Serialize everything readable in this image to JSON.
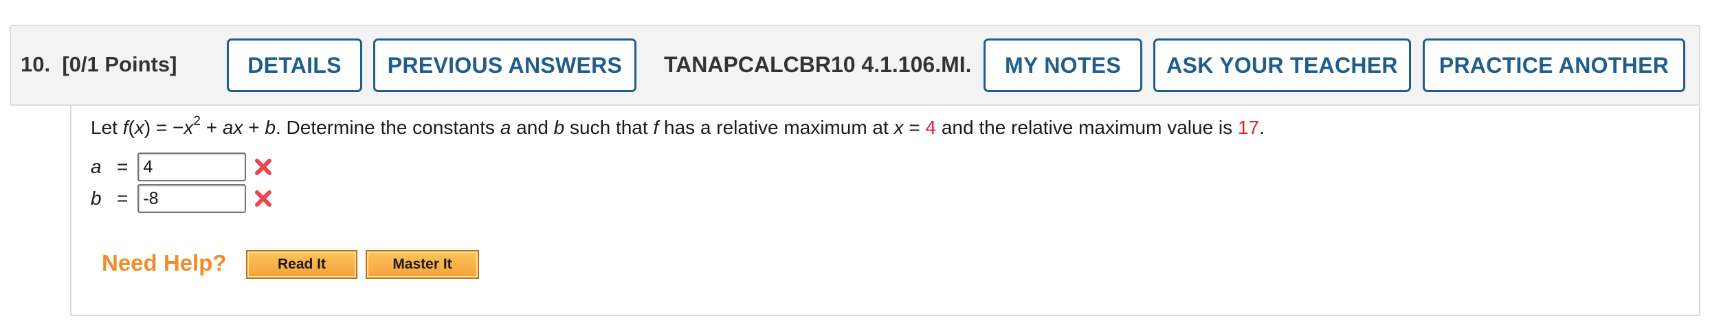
{
  "question_header": {
    "number": "10.",
    "points": "[0/1 Points]",
    "details_label": "DETAILS",
    "previous_answers_label": "PREVIOUS ANSWERS",
    "assignment_code": "TANAPCALCBR10 4.1.106.MI.",
    "my_notes_label": "MY NOTES",
    "ask_teacher_label": "ASK YOUR TEACHER",
    "practice_another_label": "PRACTICE ANOTHER"
  },
  "question": {
    "t1": "Let ",
    "f": "f",
    "t2": "(",
    "x1": "x",
    "t3": ") = −",
    "x2": "x",
    "exp": "2",
    "t4": " + ",
    "a1": "a",
    "x3": "x",
    "t5": " + ",
    "b1": "b",
    "t6": ". Determine the constants ",
    "a2": "a",
    "t7": " and ",
    "b2": "b",
    "t8": " such that ",
    "f2": "f",
    "t9": " has a relative maximum at ",
    "x4": "x",
    "t10": " = ",
    "x_value": "4",
    "t11": " and the relative maximum value is ",
    "max_value": "17",
    "t12": "."
  },
  "answers": [
    {
      "label": "a",
      "eq": "=",
      "value": "4",
      "status": "incorrect"
    },
    {
      "label": "b",
      "eq": "=",
      "value": "-8",
      "status": "incorrect"
    }
  ],
  "help": {
    "title": "Need Help?",
    "read_it_label": "Read It",
    "master_it_label": "Master It"
  },
  "colors": {
    "accent": "#1f5e8c",
    "highlight": "#e0222b",
    "help_orange": "#f28c28"
  }
}
